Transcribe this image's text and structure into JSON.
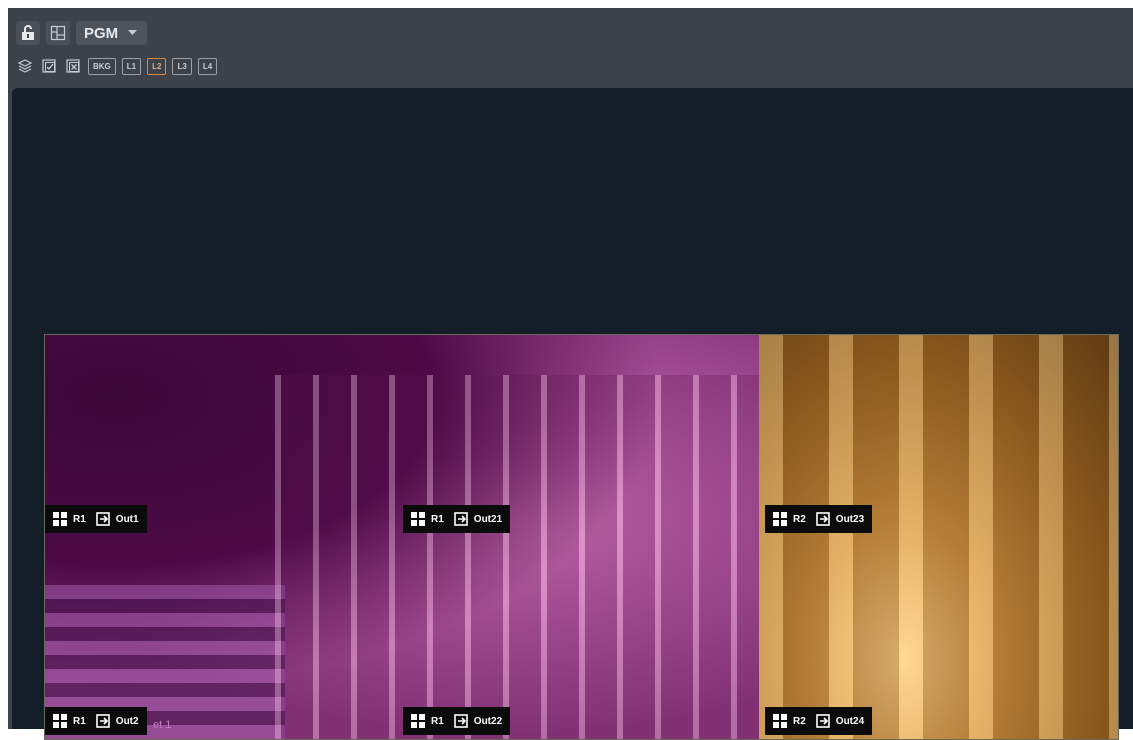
{
  "toolbar": {
    "output_select": "PGM",
    "layers": [
      {
        "label": "BKG",
        "active": false
      },
      {
        "label": "L1",
        "active": false
      },
      {
        "label": "L2",
        "active": true
      },
      {
        "label": "L3",
        "active": false
      },
      {
        "label": "L4",
        "active": false
      }
    ]
  },
  "canvas": {
    "preset_fragment": "et 1",
    "outputs": [
      {
        "region": "R1",
        "output": "Out1"
      },
      {
        "region": "R1",
        "output": "Out21"
      },
      {
        "region": "R2",
        "output": "Out23"
      },
      {
        "region": "R1",
        "output": "Out2"
      },
      {
        "region": "R1",
        "output": "Out22"
      },
      {
        "region": "R2",
        "output": "Out24"
      }
    ]
  },
  "colors": {
    "accent_active_layer": "#d58a3c",
    "canvas_bg": "#141e29",
    "toolbar_bg": "#3d4148"
  }
}
